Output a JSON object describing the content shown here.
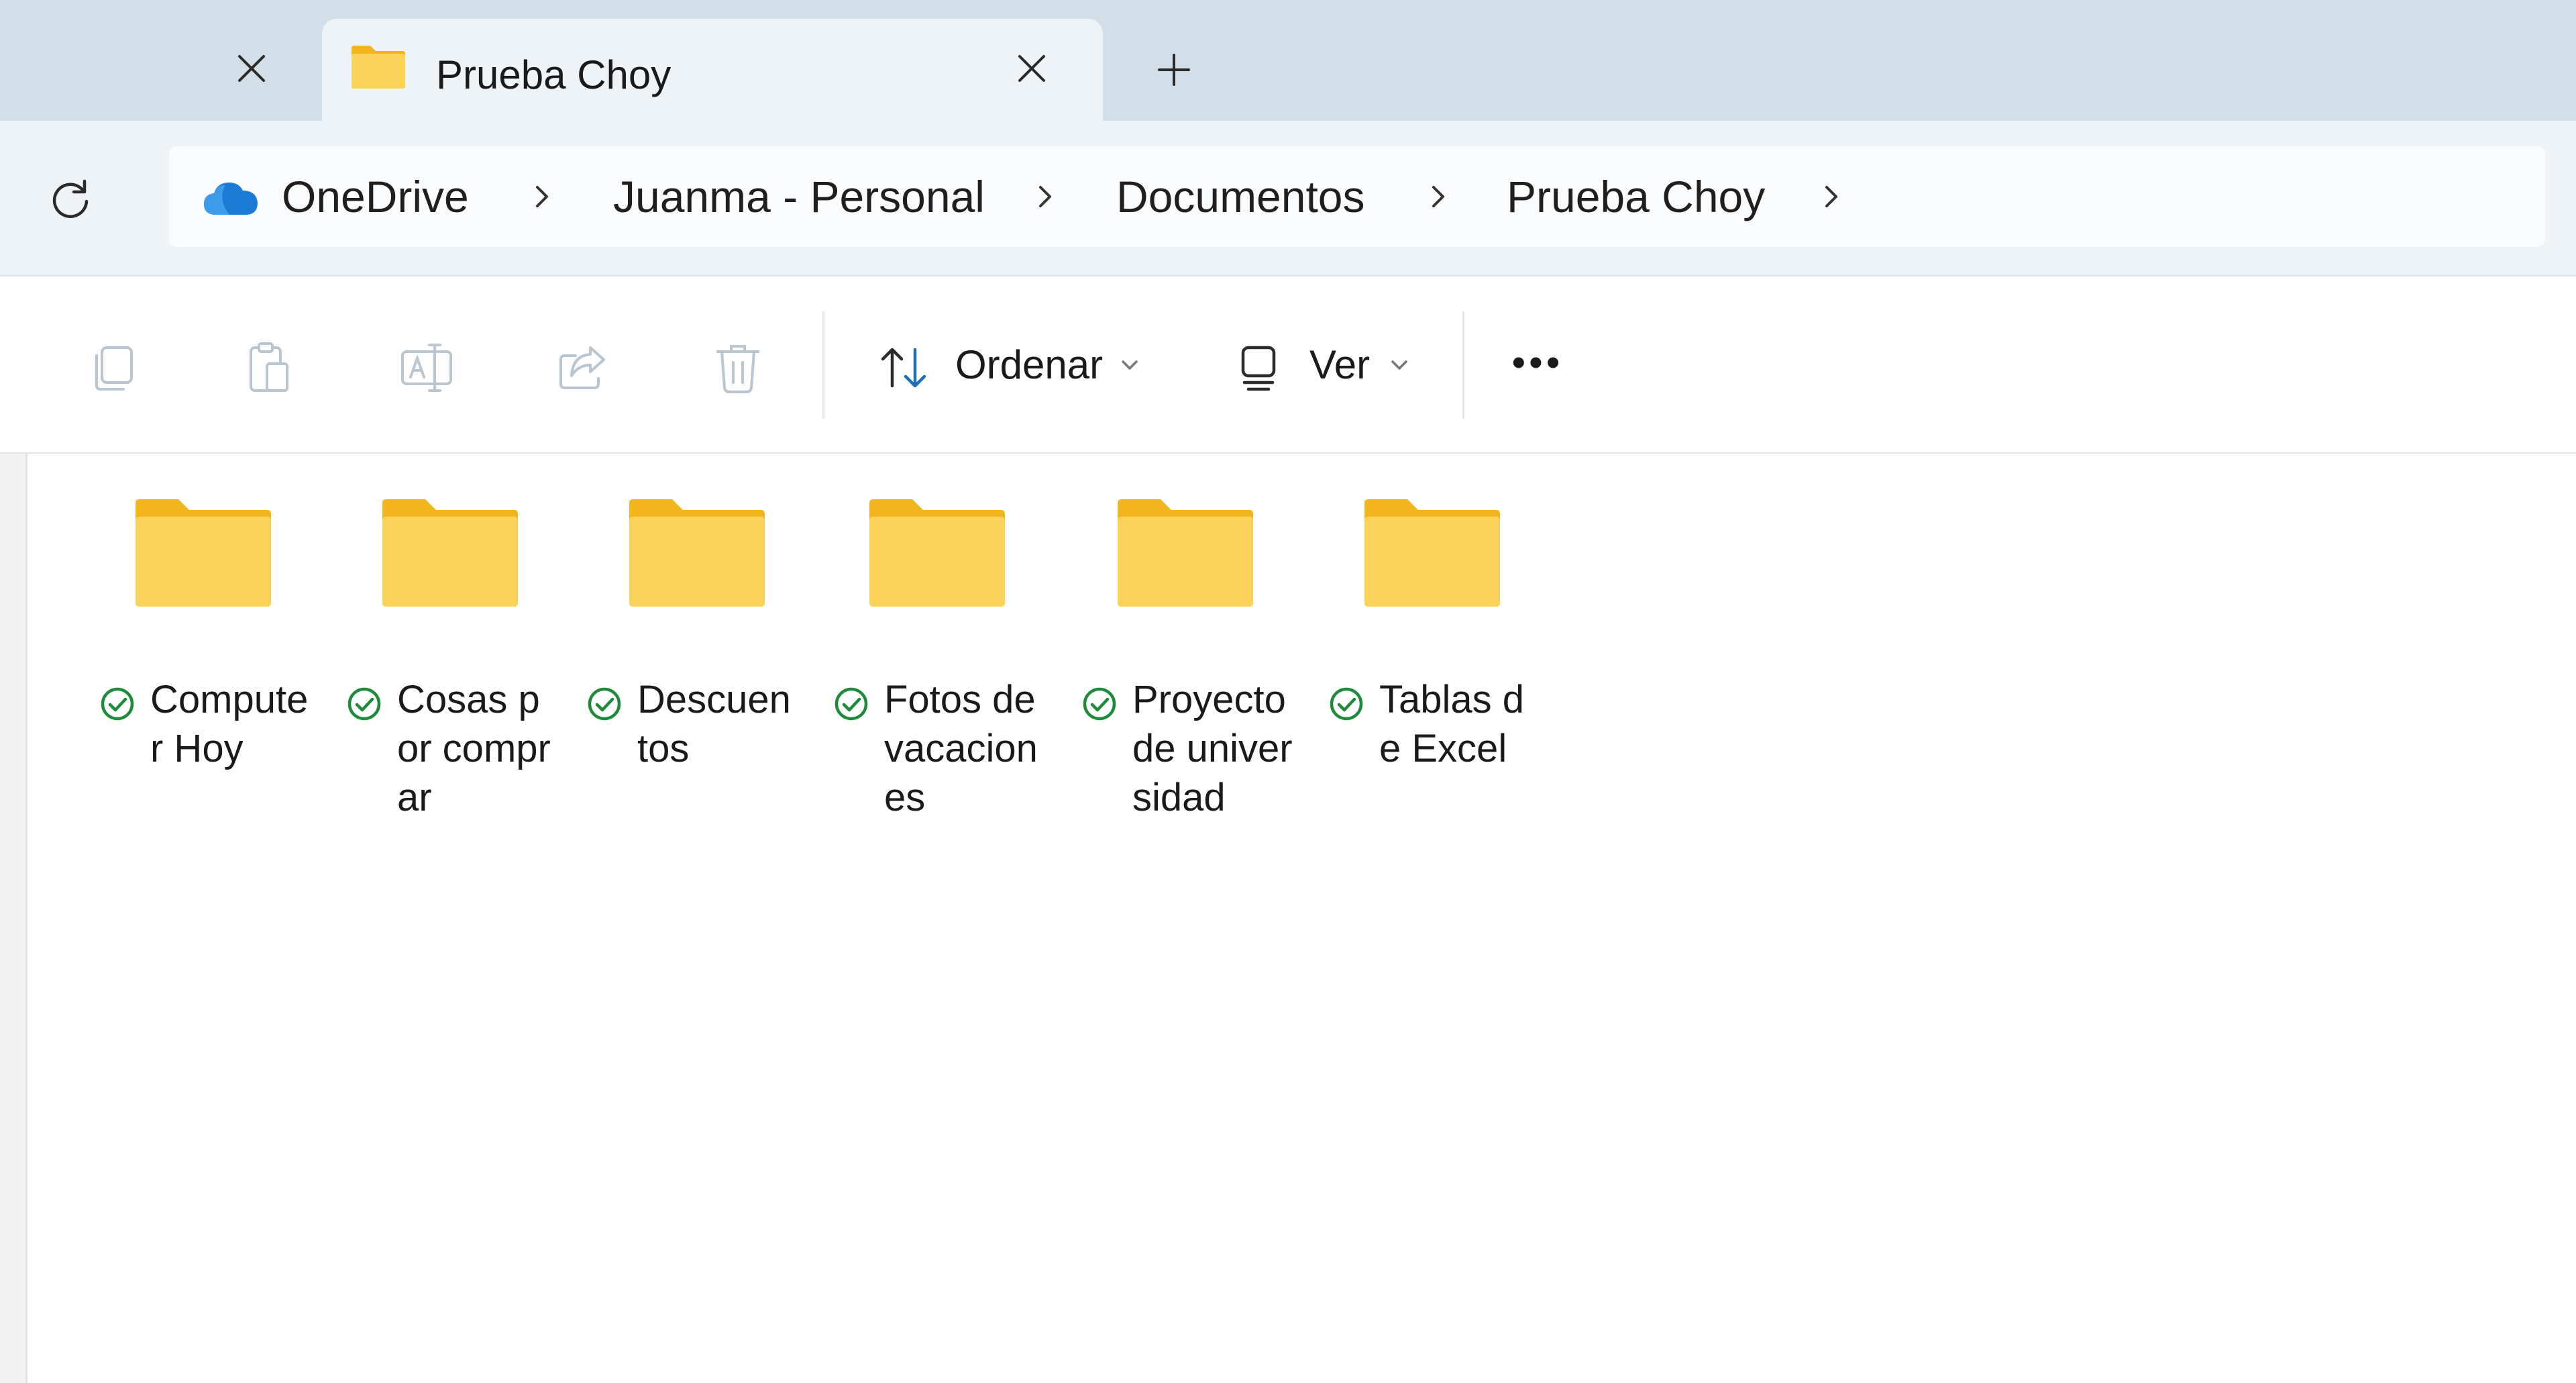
{
  "tabs": {
    "active_title": "Prueba Choy",
    "new_tab_symbol": "+"
  },
  "breadcrumb": {
    "items": [
      "OneDrive",
      "Juanma - Personal",
      "Documentos",
      "Prueba Choy"
    ],
    "root_icon": "onedrive-cloud-icon"
  },
  "toolbar": {
    "icons": [
      "copy-icon",
      "paste-icon",
      "rename-icon",
      "share-icon",
      "delete-icon"
    ],
    "sort_label": "Ordenar",
    "view_label": "Ver",
    "more_label": "•••"
  },
  "folders": [
    {
      "name": "Computer Hoy",
      "status": "synced"
    },
    {
      "name": "Cosas por comprar",
      "status": "synced"
    },
    {
      "name": "Descuentos",
      "status": "synced"
    },
    {
      "name": "Fotos de vacaciones",
      "status": "synced"
    },
    {
      "name": "Proyecto de universidad",
      "status": "synced"
    },
    {
      "name": "Tablas de Excel",
      "status": "synced"
    }
  ],
  "colors": {
    "tabbar_bg": "#d3dfe8",
    "address_bg": "#eef3f8",
    "folder_yellow": "#f7c948",
    "sync_green": "#1e8a3a",
    "onedrive_blue": "#1c7cd5",
    "sort_accent": "#1f6fb5"
  }
}
